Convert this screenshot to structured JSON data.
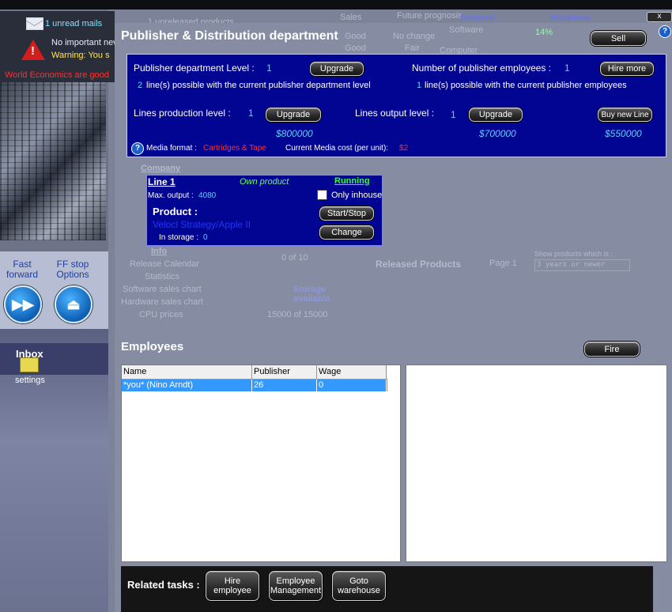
{
  "background": {
    "notifications": {
      "unread": "1 unread mails",
      "info": "No important new",
      "warning": "Warning: You s",
      "economy": "World Economics are good"
    },
    "controls": {
      "fast_forward": "Fast forward",
      "ff_stop": "FF stop Options"
    },
    "inbox": "Inbox",
    "settings": "settings",
    "faint": {
      "unreleased": "1 unreleased products",
      "sales": "Sales",
      "future": "Future prognosis",
      "demand": "Demand",
      "hardware": "Hardware",
      "good1": "Good",
      "good2": "Good",
      "no_change": "No change",
      "fair": "Fair",
      "software": "Software",
      "percent": "14%",
      "computer": "Computer",
      "company": "Company",
      "info": "Info",
      "release_calendar": "Release Calendar",
      "statistics": "Statistics",
      "software_chart": "Software sales chart",
      "hardware_chart": "Hardware sales chart",
      "cpu_prices": "CPU prices",
      "released_products": "Released Products",
      "page": "Page 1",
      "show_products": "Show products which is :",
      "filter": "3 years or newer",
      "count": "0 of 10",
      "storage": "Storage available",
      "storage_count": "15000 of 15000"
    }
  },
  "dialog": {
    "title": "Publisher & Distribution department",
    "sell": "Sell",
    "close": "x",
    "help": "?",
    "publisher": {
      "dept_level_label": "Publisher department Level :",
      "dept_level_value": "1",
      "upgrade": "Upgrade",
      "lines_possible_count": "2",
      "lines_possible_text": "line(s) possible with the current publisher department level",
      "employees_label": "Number of publisher employees :",
      "employees_value": "1",
      "hire_more": "Hire more",
      "emp_lines_count": "1",
      "emp_lines_text": "line(s) possible with the current publisher employees",
      "production_label": "Lines production level :",
      "production_value": "1",
      "production_upgrade": "Upgrade",
      "production_price": "$800000",
      "output_label": "Lines output level :",
      "output_value": "1",
      "output_upgrade": "Upgrade",
      "output_price": "$700000",
      "buy_line": "Buy new Line",
      "buy_price": "$550000",
      "media_format_label": "Media format :",
      "media_format_value": "Cartridges & Tape",
      "media_cost_label": "Current Media cost (per unit):",
      "media_cost_value": "$2"
    },
    "line": {
      "title": "Line 1",
      "own_product": "Own product",
      "status": "Running",
      "max_output_label": "Max. output :",
      "max_output_value": "4080",
      "only_inhouse": "Only inhouse",
      "product_label": "Product :",
      "product_value": "Velocl Strategy/Apple II",
      "start_stop": "Start/Stop",
      "change": "Change",
      "storage_label": "In storage :",
      "storage_value": "0"
    },
    "employees": {
      "title": "Employees",
      "fire": "Fire",
      "columns": [
        "Name",
        "Publisher",
        "Wage"
      ],
      "rows": [
        [
          "*you* (Nino Arndt)",
          "26",
          "0"
        ]
      ]
    },
    "related": {
      "label": "Related tasks :",
      "hire": "Hire employee",
      "management": "Employee Management",
      "warehouse": "Goto warehouse"
    }
  }
}
